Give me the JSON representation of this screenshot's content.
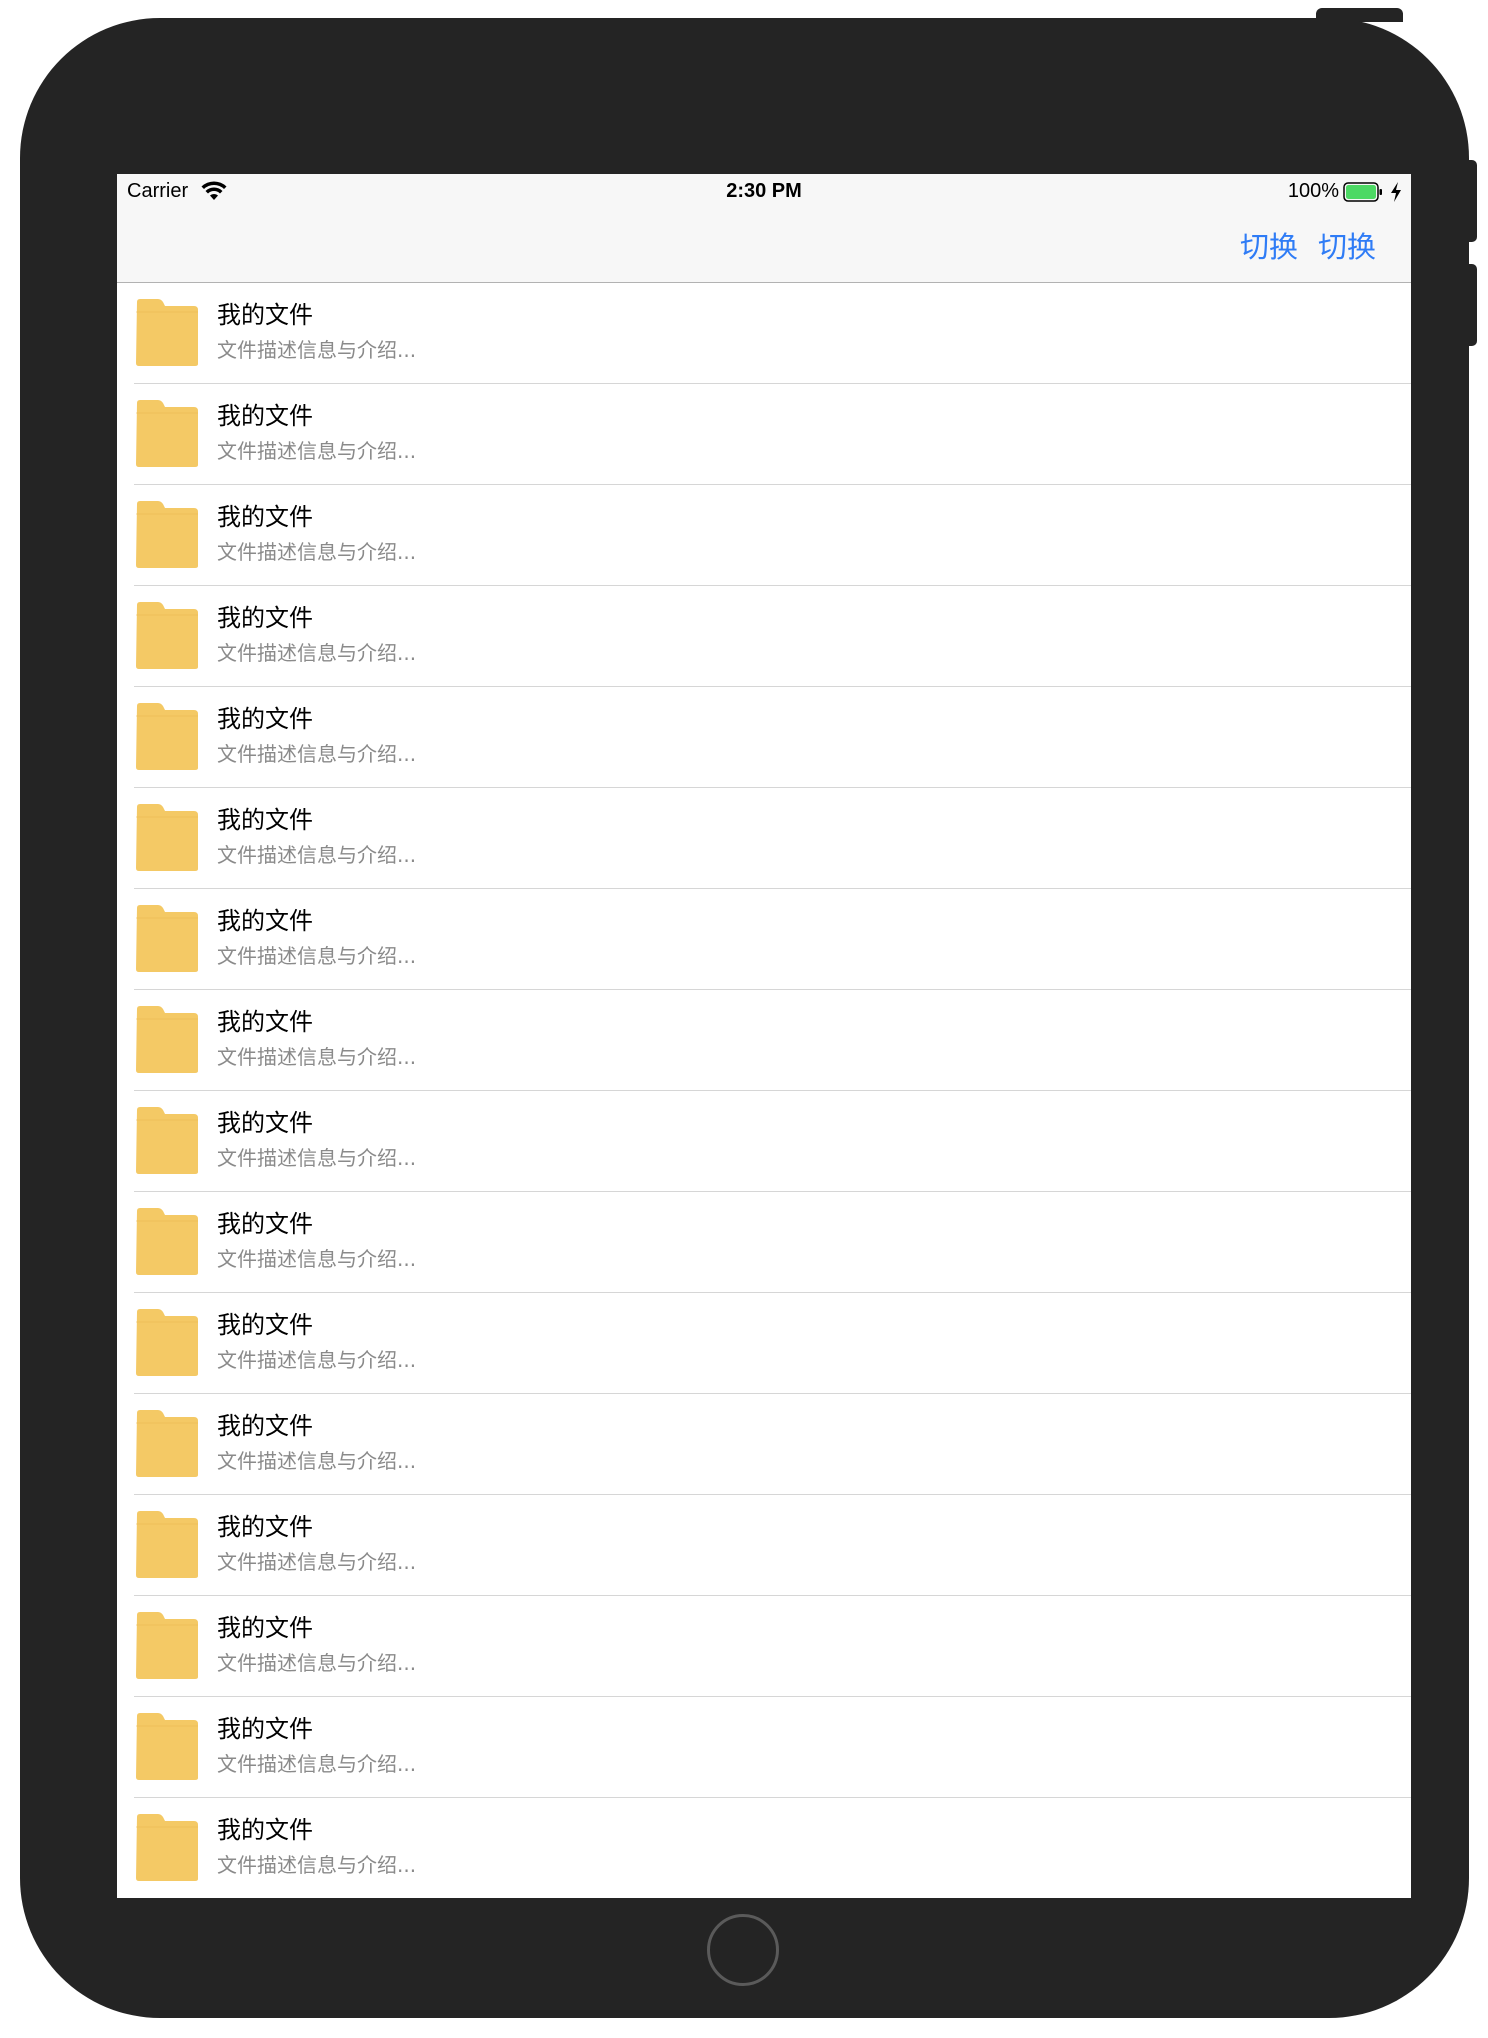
{
  "status_bar": {
    "carrier": "Carrier",
    "time": "2:30 PM",
    "battery": "100%",
    "battery_color": "#4cd964"
  },
  "nav": {
    "buttons": [
      "切换",
      "切换"
    ],
    "tint_color": "#2f7cf6"
  },
  "list": {
    "folder_color": "#f4c965",
    "items": [
      {
        "title": "我的文件",
        "subtitle": "文件描述信息与介绍..."
      },
      {
        "title": "我的文件",
        "subtitle": "文件描述信息与介绍..."
      },
      {
        "title": "我的文件",
        "subtitle": "文件描述信息与介绍..."
      },
      {
        "title": "我的文件",
        "subtitle": "文件描述信息与介绍..."
      },
      {
        "title": "我的文件",
        "subtitle": "文件描述信息与介绍..."
      },
      {
        "title": "我的文件",
        "subtitle": "文件描述信息与介绍..."
      },
      {
        "title": "我的文件",
        "subtitle": "文件描述信息与介绍..."
      },
      {
        "title": "我的文件",
        "subtitle": "文件描述信息与介绍..."
      },
      {
        "title": "我的文件",
        "subtitle": "文件描述信息与介绍..."
      },
      {
        "title": "我的文件",
        "subtitle": "文件描述信息与介绍..."
      },
      {
        "title": "我的文件",
        "subtitle": "文件描述信息与介绍..."
      },
      {
        "title": "我的文件",
        "subtitle": "文件描述信息与介绍..."
      },
      {
        "title": "我的文件",
        "subtitle": "文件描述信息与介绍..."
      },
      {
        "title": "我的文件",
        "subtitle": "文件描述信息与介绍..."
      },
      {
        "title": "我的文件",
        "subtitle": "文件描述信息与介绍..."
      },
      {
        "title": "我的文件",
        "subtitle": "文件描述信息与介绍..."
      }
    ]
  }
}
